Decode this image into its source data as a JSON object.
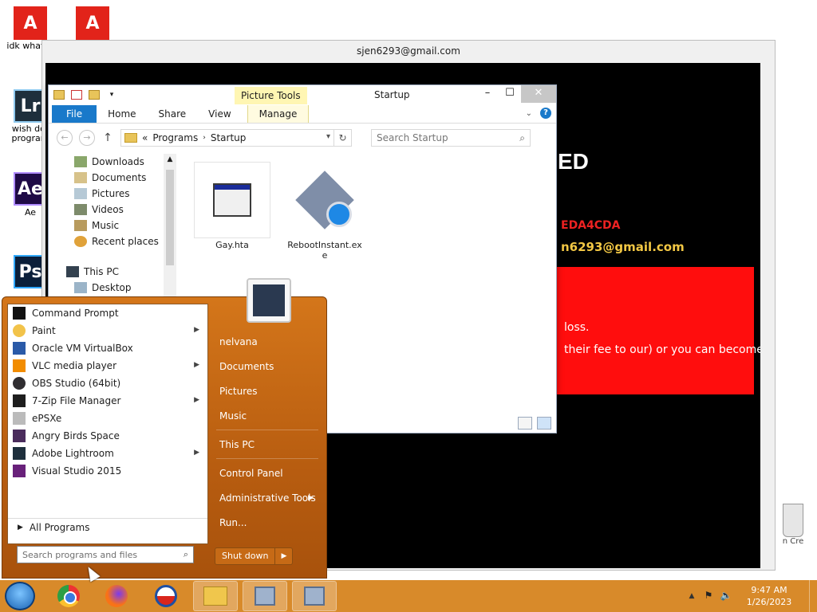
{
  "desktop": {
    "icons": [
      {
        "label": "idk what is",
        "icon": "adobe-icon"
      },
      {
        "label": "",
        "icon": "adobe-icon"
      },
      {
        "label": "wish dot program",
        "icon": "lightroom-icon"
      },
      {
        "label": "Ae",
        "icon": "after-effects-icon"
      },
      {
        "label": "",
        "icon": "photoshop-icon"
      }
    ],
    "recycle_bin_label": "n Cre"
  },
  "ransom": {
    "title": "sjen6293@gmail.com",
    "heading": "ED",
    "id_text": "EDA4CDA",
    "email_text": "n6293@gmail.com",
    "line1": "loss.",
    "line2": "their fee to our) or you can become"
  },
  "explorer": {
    "title": "Startup",
    "contextual_tab": "Picture Tools",
    "ribbon_tabs": [
      "File",
      "Home",
      "Share",
      "View",
      "Manage"
    ],
    "address_prefix": "«",
    "breadcrumb": [
      "Programs",
      "Startup"
    ],
    "search_placeholder": "Search Startup",
    "nav_items": [
      "Downloads",
      "Documents",
      "Pictures",
      "Videos",
      "Music",
      "Recent places"
    ],
    "this_pc": "This PC",
    "desktop": "Desktop",
    "files": [
      {
        "name": "Gay.hta",
        "icon": "hta-file-icon"
      },
      {
        "name": "RebootInstant.exe",
        "icon": "exe-file-icon"
      }
    ]
  },
  "start_menu": {
    "programs": [
      {
        "label": "Command Prompt",
        "icon": "cmd-icon",
        "submenu": false
      },
      {
        "label": "Paint",
        "icon": "paint-icon",
        "submenu": true
      },
      {
        "label": "Oracle VM VirtualBox",
        "icon": "virtualbox-icon",
        "submenu": false
      },
      {
        "label": "VLC media player",
        "icon": "vlc-icon",
        "submenu": true
      },
      {
        "label": "OBS Studio (64bit)",
        "icon": "obs-icon",
        "submenu": false
      },
      {
        "label": "7-Zip File Manager",
        "icon": "7zip-icon",
        "submenu": true
      },
      {
        "label": "ePSXe",
        "icon": "epsxe-icon",
        "submenu": false
      },
      {
        "label": "Angry Birds Space",
        "icon": "angry-birds-icon",
        "submenu": false
      },
      {
        "label": "Adobe Lightroom",
        "icon": "lightroom-icon",
        "submenu": true
      },
      {
        "label": "Visual Studio 2015",
        "icon": "visual-studio-icon",
        "submenu": false
      }
    ],
    "all_programs": "All Programs",
    "search_placeholder": "Search programs and files",
    "right_links": [
      {
        "label": "nelvana",
        "submenu": false
      },
      {
        "label": "Documents",
        "submenu": false
      },
      {
        "label": "Pictures",
        "submenu": false
      },
      {
        "label": "Music",
        "submenu": false
      },
      {
        "label": "This PC",
        "submenu": false
      },
      {
        "label": "Control Panel",
        "submenu": false
      },
      {
        "label": "Administrative Tools",
        "submenu": true
      },
      {
        "label": "Run...",
        "submenu": false
      }
    ],
    "shutdown": "Shut down"
  },
  "taskbar": {
    "time": "9:47 AM",
    "date": "1/26/2023",
    "apps": [
      "chrome-icon",
      "firefox-icon",
      "obama-icon",
      "file-explorer-icon",
      "network-pc-icon",
      "network-pc-icon"
    ]
  }
}
